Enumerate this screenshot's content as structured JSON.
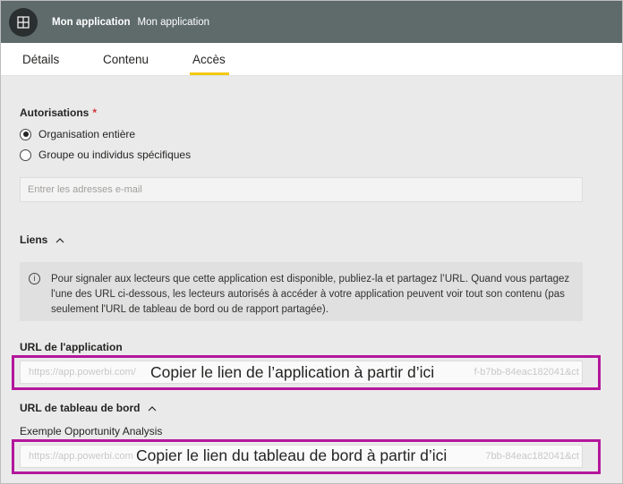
{
  "header": {
    "app_name": "Mon application",
    "app_subtitle": "Mon application",
    "logo_icon": "app-grid-icon",
    "background": "#5f6b6b"
  },
  "tabs": [
    {
      "label": "Détails",
      "active": false
    },
    {
      "label": "Contenu",
      "active": false
    },
    {
      "label": "Accès",
      "active": true
    }
  ],
  "accent_color": "#f2c811",
  "permissions": {
    "title": "Autorisations",
    "required_marker": "*",
    "options": [
      {
        "label": "Organisation entière",
        "selected": true
      },
      {
        "label": "Groupe ou individus spécifiques",
        "selected": false
      }
    ],
    "email_placeholder": "Entrer les adresses e-mail",
    "email_value": ""
  },
  "links": {
    "title": "Liens",
    "info_icon": "info-icon",
    "info_text": "Pour signaler aux lecteurs que cette application est disponible, publiez-la et partagez l’URL. Quand vous partagez l'une des URL ci-dessous, les lecteurs autorisés à accéder à votre application peuvent voir tout son contenu (pas seulement l'URL de tableau de bord ou de rapport partagée)."
  },
  "app_url": {
    "title": "URL de l'application",
    "value_start": "https://app.powerbi.com/",
    "value_end": "f-b7bb-84eac182041&ct",
    "callout": "Copier le lien de l’application à partir d’ici"
  },
  "dashboard_url": {
    "title": "URL de tableau de bord",
    "dashboard_name": "Exemple Opportunity Analysis",
    "value_start": "https://app.powerbi.com/",
    "value_end": "7bb-84eac182041&ct",
    "callout": "Copier le lien du tableau de bord à partir d’ici"
  },
  "callout_color": "#b4179c"
}
